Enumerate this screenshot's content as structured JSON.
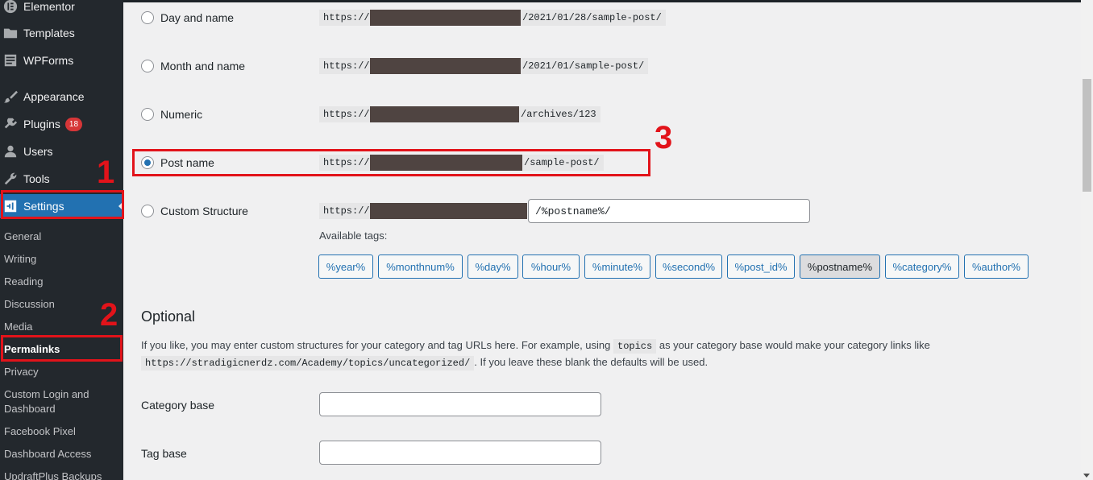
{
  "sidebar": {
    "menu": [
      {
        "label": "Elementor",
        "icon": "elementor-icon"
      },
      {
        "label": "Templates",
        "icon": "folder-icon"
      },
      {
        "label": "WPForms",
        "icon": "forms-icon"
      },
      {
        "label": "Appearance",
        "icon": "brush-icon"
      },
      {
        "label": "Plugins",
        "icon": "plugin-icon",
        "badge": "18"
      },
      {
        "label": "Users",
        "icon": "user-icon"
      },
      {
        "label": "Tools",
        "icon": "wrench-icon"
      },
      {
        "label": "Settings",
        "icon": "settings-icon",
        "current": true
      }
    ],
    "submenu": [
      "General",
      "Writing",
      "Reading",
      "Discussion",
      "Media",
      "Permalinks",
      "Privacy",
      "Custom Login and Dashboard",
      "Facebook Pixel",
      "Dashboard Access",
      "UpdraftPlus Backups"
    ]
  },
  "annotations": {
    "one": "1",
    "two": "2",
    "three": "3",
    "color": "#e2131a"
  },
  "permalinks": {
    "url_prefix": "https://",
    "options": [
      {
        "label": "Day and name",
        "suffix": "/2021/01/28/sample-post/",
        "checked": false
      },
      {
        "label": "Month and name",
        "suffix": "/2021/01/sample-post/",
        "checked": false
      },
      {
        "label": "Numeric",
        "suffix": "/archives/123",
        "checked": false
      },
      {
        "label": "Post name",
        "suffix": "/sample-post/",
        "checked": true
      },
      {
        "label": "Custom Structure",
        "custom_value": "/%postname%/",
        "checked": false
      }
    ],
    "available_tags_label": "Available tags:",
    "tags": [
      "%year%",
      "%monthnum%",
      "%day%",
      "%hour%",
      "%minute%",
      "%second%",
      "%post_id%",
      "%postname%",
      "%category%",
      "%author%"
    ],
    "active_tag": "%postname%"
  },
  "optional": {
    "heading": "Optional",
    "text_1": "If you like, you may enter custom structures for your category and tag URLs here. For example, using",
    "code_1": "topics",
    "text_2": "as your category base would make your category links like",
    "code_2": "https://stradigicnerdz.com/Academy/topics/uncategorized/",
    "text_3": ". If you leave these blank the defaults will be used.",
    "category_base_label": "Category base",
    "category_base_value": "",
    "tag_base_label": "Tag base",
    "tag_base_value": ""
  },
  "colors": {
    "accent": "#2271b1",
    "sidebar": "#23282d",
    "annotation": "#e2131a"
  }
}
